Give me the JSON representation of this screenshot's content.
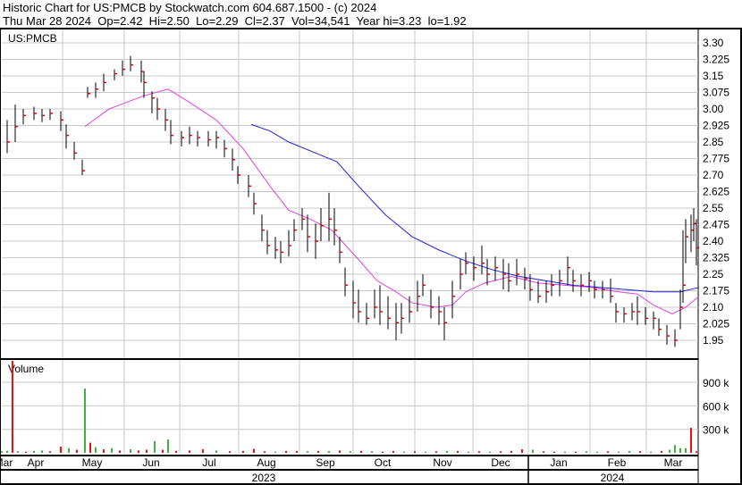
{
  "header": {
    "title": "Historic Chart for US:PMCB by Stockwatch.com 604.687.1500 - (c) 2024",
    "quote": "Thu Mar 28 2024  Op=2.42  Hi=2.50  Lo=2.29  Cl=2.37  Vol=34,541  Year hi=3.23  lo=1.92"
  },
  "chart_data": {
    "type": "line",
    "symbol": "US:PMCB",
    "volume_label": "Volume",
    "x_unit": "trading-day index since ~Mar 20 2023",
    "price_ticks": [
      "3.30",
      "3.225",
      "3.15",
      "3.075",
      "3.00",
      "2.925",
      "2.85",
      "2.775",
      "2.70",
      "2.625",
      "2.55",
      "2.475",
      "2.40",
      "2.325",
      "2.25",
      "2.175",
      "2.10",
      "2.025",
      "1.95"
    ],
    "ylim": [
      1.95,
      3.3
    ],
    "volume_ticks": [
      "900 k",
      "600 k",
      "300 k"
    ],
    "volume_ylim": [
      0,
      1200000
    ],
    "months": [
      "Mar",
      "Apr",
      "May",
      "Jun",
      "Jul",
      "Aug",
      "Sep",
      "Oct",
      "Nov",
      "Dec",
      "Jan",
      "Feb",
      "Mar"
    ],
    "years": [
      "2023",
      "2024"
    ],
    "colors": {
      "bar": "#000000",
      "close": "#e00000",
      "ma50": "#e040e0",
      "ma200": "#2020e0",
      "vol_up": "#40b040",
      "vol_down": "#ee1010",
      "grid": "#c8c8c8"
    },
    "ohlc": [
      [
        2,
        2.8,
        2.95,
        2.85
      ],
      [
        5,
        2.85,
        3.02,
        2.92
      ],
      [
        8,
        2.93,
        3.0,
        2.97
      ],
      [
        12,
        2.95,
        3.01,
        2.98
      ],
      [
        15,
        2.94,
        3.0,
        2.97
      ],
      [
        18,
        2.95,
        3.0,
        2.98
      ],
      [
        22,
        2.9,
        2.99,
        2.95
      ],
      [
        24,
        2.82,
        2.93,
        2.88
      ],
      [
        27,
        2.77,
        2.85,
        2.8
      ],
      [
        30,
        2.7,
        2.77,
        2.72
      ],
      [
        32,
        3.05,
        3.1,
        3.07
      ],
      [
        35,
        3.05,
        3.12,
        3.09
      ],
      [
        38,
        3.08,
        3.16,
        3.12
      ],
      [
        42,
        3.13,
        3.18,
        3.16
      ],
      [
        45,
        3.15,
        3.22,
        3.18
      ],
      [
        48,
        3.17,
        3.24,
        3.2
      ],
      [
        52,
        3.12,
        3.22,
        3.17
      ],
      [
        53,
        3.05,
        3.17,
        3.12
      ],
      [
        56,
        2.98,
        3.08,
        3.05
      ],
      [
        58,
        2.95,
        3.05,
        3.0
      ],
      [
        61,
        2.9,
        3.0,
        2.95
      ],
      [
        63,
        2.84,
        2.95,
        2.88
      ],
      [
        67,
        2.83,
        2.9,
        2.87
      ],
      [
        70,
        2.84,
        2.92,
        2.88
      ],
      [
        73,
        2.83,
        2.9,
        2.87
      ],
      [
        77,
        2.83,
        2.9,
        2.86
      ],
      [
        80,
        2.82,
        2.9,
        2.87
      ],
      [
        83,
        2.78,
        2.86,
        2.82
      ],
      [
        86,
        2.72,
        2.82,
        2.77
      ],
      [
        88,
        2.66,
        2.74,
        2.7
      ],
      [
        92,
        2.6,
        2.7,
        2.65
      ],
      [
        94,
        2.52,
        2.62,
        2.57
      ],
      [
        97,
        2.4,
        2.52,
        2.45
      ],
      [
        99,
        2.34,
        2.45,
        2.38
      ],
      [
        102,
        2.32,
        2.42,
        2.36
      ],
      [
        104,
        2.3,
        2.4,
        2.35
      ],
      [
        107,
        2.33,
        2.45,
        2.38
      ],
      [
        109,
        2.4,
        2.5,
        2.45
      ],
      [
        112,
        2.45,
        2.55,
        2.5
      ],
      [
        114,
        2.35,
        2.52,
        2.42
      ],
      [
        117,
        2.32,
        2.48,
        2.4
      ],
      [
        119,
        2.4,
        2.55,
        2.47
      ],
      [
        122,
        2.4,
        2.62,
        2.5
      ],
      [
        124,
        2.38,
        2.55,
        2.45
      ],
      [
        126,
        2.3,
        2.42,
        2.35
      ],
      [
        128,
        2.15,
        2.28,
        2.2
      ],
      [
        131,
        2.05,
        2.22,
        2.12
      ],
      [
        133,
        2.03,
        2.18,
        2.08
      ],
      [
        136,
        2.02,
        2.12,
        2.05
      ],
      [
        139,
        2.05,
        2.18,
        2.1
      ],
      [
        141,
        2.02,
        2.2,
        2.08
      ],
      [
        144,
        2.0,
        2.15,
        2.05
      ],
      [
        147,
        1.95,
        2.12,
        2.03
      ],
      [
        149,
        1.98,
        2.12,
        2.05
      ],
      [
        152,
        2.03,
        2.15,
        2.08
      ],
      [
        155,
        2.08,
        2.22,
        2.15
      ],
      [
        157,
        2.15,
        2.25,
        2.2
      ],
      [
        160,
        2.05,
        2.18,
        2.1
      ],
      [
        163,
        2.02,
        2.15,
        2.08
      ],
      [
        165,
        1.95,
        2.1,
        2.03
      ],
      [
        168,
        2.05,
        2.22,
        2.15
      ],
      [
        171,
        2.18,
        2.32,
        2.25
      ],
      [
        173,
        2.25,
        2.35,
        2.3
      ],
      [
        176,
        2.22,
        2.33,
        2.28
      ],
      [
        179,
        2.25,
        2.38,
        2.3
      ],
      [
        181,
        2.2,
        2.32,
        2.25
      ],
      [
        184,
        2.22,
        2.33,
        2.28
      ],
      [
        187,
        2.18,
        2.32,
        2.25
      ],
      [
        189,
        2.17,
        2.3,
        2.22
      ],
      [
        192,
        2.2,
        2.32,
        2.25
      ],
      [
        195,
        2.18,
        2.28,
        2.23
      ],
      [
        197,
        2.13,
        2.25,
        2.18
      ],
      [
        200,
        2.12,
        2.22,
        2.15
      ],
      [
        203,
        2.12,
        2.22,
        2.17
      ],
      [
        205,
        2.15,
        2.25,
        2.2
      ],
      [
        208,
        2.15,
        2.27,
        2.22
      ],
      [
        211,
        2.2,
        2.33,
        2.28
      ],
      [
        213,
        2.17,
        2.27,
        2.22
      ],
      [
        216,
        2.15,
        2.25,
        2.2
      ],
      [
        219,
        2.17,
        2.26,
        2.22
      ],
      [
        221,
        2.14,
        2.22,
        2.18
      ],
      [
        224,
        2.14,
        2.22,
        2.18
      ],
      [
        227,
        2.12,
        2.23,
        2.15
      ],
      [
        229,
        2.03,
        2.12,
        2.08
      ],
      [
        232,
        2.03,
        2.1,
        2.07
      ],
      [
        235,
        2.04,
        2.12,
        2.08
      ],
      [
        237,
        2.02,
        2.15,
        2.08
      ],
      [
        240,
        2.02,
        2.1,
        2.05
      ],
      [
        243,
        2.0,
        2.08,
        2.05
      ],
      [
        245,
        1.97,
        2.05,
        2.0
      ],
      [
        248,
        1.93,
        2.02,
        1.97
      ],
      [
        251,
        1.92,
        2.0,
        1.95
      ],
      [
        253,
        2.0,
        2.18,
        2.1
      ],
      [
        254,
        2.12,
        2.45,
        2.2
      ],
      [
        255,
        2.3,
        2.5,
        2.42
      ],
      [
        257,
        2.35,
        2.52,
        2.45
      ],
      [
        258,
        2.4,
        2.55,
        2.48
      ],
      [
        259,
        2.29,
        2.5,
        2.37
      ]
    ],
    "ma50": [
      [
        31,
        2.92
      ],
      [
        40,
        3.0
      ],
      [
        53,
        3.06
      ],
      [
        62,
        3.09
      ],
      [
        70,
        3.03
      ],
      [
        80,
        2.95
      ],
      [
        90,
        2.82
      ],
      [
        100,
        2.65
      ],
      [
        107,
        2.54
      ],
      [
        115,
        2.5
      ],
      [
        123,
        2.45
      ],
      [
        132,
        2.33
      ],
      [
        140,
        2.22
      ],
      [
        147,
        2.17
      ],
      [
        153,
        2.12
      ],
      [
        162,
        2.1
      ],
      [
        168,
        2.11
      ],
      [
        173,
        2.17
      ],
      [
        180,
        2.21
      ],
      [
        190,
        2.24
      ],
      [
        200,
        2.21
      ],
      [
        210,
        2.2
      ],
      [
        220,
        2.19
      ],
      [
        230,
        2.17
      ],
      [
        237,
        2.16
      ],
      [
        243,
        2.11
      ],
      [
        250,
        2.07
      ],
      [
        255,
        2.1
      ],
      [
        260,
        2.15
      ]
    ],
    "ma200": [
      [
        93,
        2.93
      ],
      [
        100,
        2.9
      ],
      [
        107,
        2.85
      ],
      [
        117,
        2.8
      ],
      [
        125,
        2.76
      ],
      [
        133,
        2.65
      ],
      [
        143,
        2.52
      ],
      [
        153,
        2.42
      ],
      [
        163,
        2.36
      ],
      [
        173,
        2.31
      ],
      [
        183,
        2.27
      ],
      [
        193,
        2.24
      ],
      [
        203,
        2.22
      ],
      [
        213,
        2.2
      ],
      [
        223,
        2.19
      ],
      [
        233,
        2.18
      ],
      [
        243,
        2.17
      ],
      [
        253,
        2.17
      ],
      [
        260,
        2.19
      ]
    ],
    "volume": [
      [
        0,
        20000,
        "up"
      ],
      [
        2,
        25000,
        "up"
      ],
      [
        4,
        1200000,
        "down"
      ],
      [
        6,
        20000,
        "up"
      ],
      [
        9,
        15000,
        "down"
      ],
      [
        12,
        25000,
        "up"
      ],
      [
        15,
        30000,
        "up"
      ],
      [
        18,
        20000,
        "down"
      ],
      [
        22,
        80000,
        "down"
      ],
      [
        25,
        60000,
        "up"
      ],
      [
        28,
        40000,
        "down"
      ],
      [
        31,
        820000,
        "up"
      ],
      [
        33,
        130000,
        "down"
      ],
      [
        35,
        70000,
        "up"
      ],
      [
        38,
        45000,
        "down"
      ],
      [
        41,
        60000,
        "up"
      ],
      [
        44,
        30000,
        "down"
      ],
      [
        48,
        45000,
        "up"
      ],
      [
        51,
        30000,
        "down"
      ],
      [
        54,
        40000,
        "down"
      ],
      [
        57,
        150000,
        "up"
      ],
      [
        60,
        40000,
        "down"
      ],
      [
        62,
        170000,
        "up"
      ],
      [
        65,
        25000,
        "down"
      ],
      [
        70,
        30000,
        "down"
      ],
      [
        75,
        45000,
        "down"
      ],
      [
        80,
        30000,
        "up"
      ],
      [
        85,
        20000,
        "down"
      ],
      [
        90,
        25000,
        "down"
      ],
      [
        94,
        50000,
        "down"
      ],
      [
        98,
        20000,
        "down"
      ],
      [
        102,
        15000,
        "up"
      ],
      [
        106,
        25000,
        "down"
      ],
      [
        110,
        25000,
        "down"
      ],
      [
        114,
        20000,
        "up"
      ],
      [
        118,
        25000,
        "down"
      ],
      [
        122,
        25000,
        "up"
      ],
      [
        126,
        30000,
        "down"
      ],
      [
        130,
        20000,
        "up"
      ],
      [
        134,
        25000,
        "down"
      ],
      [
        138,
        20000,
        "up"
      ],
      [
        142,
        15000,
        "down"
      ],
      [
        146,
        25000,
        "down"
      ],
      [
        150,
        15000,
        "up"
      ],
      [
        154,
        20000,
        "down"
      ],
      [
        158,
        15000,
        "up"
      ],
      [
        162,
        20000,
        "down"
      ],
      [
        166,
        25000,
        "up"
      ],
      [
        170,
        25000,
        "down"
      ],
      [
        174,
        15000,
        "up"
      ],
      [
        178,
        20000,
        "down"
      ],
      [
        182,
        15000,
        "up"
      ],
      [
        186,
        20000,
        "down"
      ],
      [
        190,
        25000,
        "down"
      ],
      [
        194,
        45000,
        "down"
      ],
      [
        198,
        40000,
        "up"
      ],
      [
        202,
        20000,
        "down"
      ],
      [
        206,
        15000,
        "down"
      ],
      [
        210,
        15000,
        "up"
      ],
      [
        214,
        15000,
        "down"
      ],
      [
        218,
        20000,
        "up"
      ],
      [
        222,
        15000,
        "up"
      ],
      [
        226,
        20000,
        "down"
      ],
      [
        230,
        15000,
        "up"
      ],
      [
        234,
        25000,
        "up"
      ],
      [
        238,
        20000,
        "down"
      ],
      [
        242,
        15000,
        "up"
      ],
      [
        246,
        25000,
        "down"
      ],
      [
        249,
        40000,
        "up"
      ],
      [
        251,
        100000,
        "up"
      ],
      [
        253,
        60000,
        "up"
      ],
      [
        255,
        60000,
        "up"
      ],
      [
        257,
        320000,
        "down"
      ],
      [
        259,
        20000,
        "down"
      ]
    ]
  }
}
